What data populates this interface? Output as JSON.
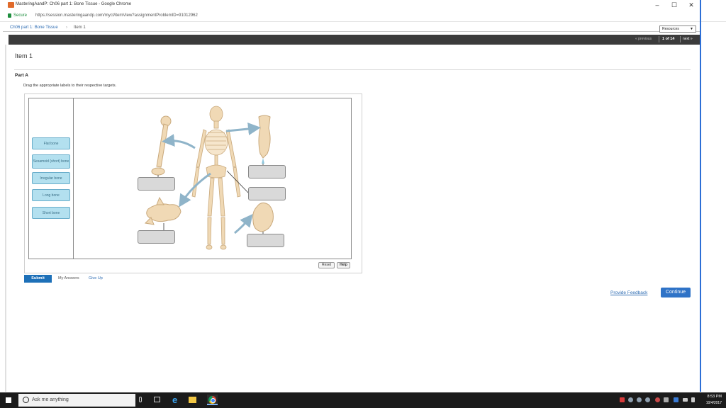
{
  "browser": {
    "window_title": "MasteringAandP: Ch06 part 1: Bone Tissue - Google Chrome",
    "secure_label": "Secure",
    "url": "https://session.masteringaandp.com/myct/itemView?assignmentProblemID=91012962",
    "controls": {
      "minimize": "–",
      "maximize": "☐",
      "close": "✕"
    }
  },
  "header": {
    "breadcrumb": [
      "Ch06 part 1: Bone Tissue",
      "Item 1"
    ],
    "breadcrumb_sep": "›",
    "resources_label": "Resources",
    "nav": {
      "previous": "« previous",
      "position": "1 of 14",
      "next": "next »"
    }
  },
  "main": {
    "item_title": "Item 1",
    "part_label": "Part A",
    "instructions": "Drag the appropriate labels to their respective targets.",
    "labels": [
      "Flat bone",
      "Sesamoid (short) bone",
      "Irregular bone",
      "Long bone",
      "Short bone"
    ],
    "reset_label": "Reset",
    "help_label": "Help",
    "submit_label": "Submit",
    "my_answers_label": "My Answers",
    "give_up_label": "Give Up",
    "feedback_label": "Provide Feedback",
    "continue_label": "Continue"
  },
  "taskbar": {
    "search_placeholder": "Ask me anything",
    "time": "8:53 PM",
    "date": "10/4/2017"
  },
  "colors": {
    "accent": "#1d70b8",
    "label_chip": "#b3e0ef",
    "navbar": "#3b3b3b",
    "bone": "#f0d9b5",
    "arrow": "#8fb4c9"
  }
}
